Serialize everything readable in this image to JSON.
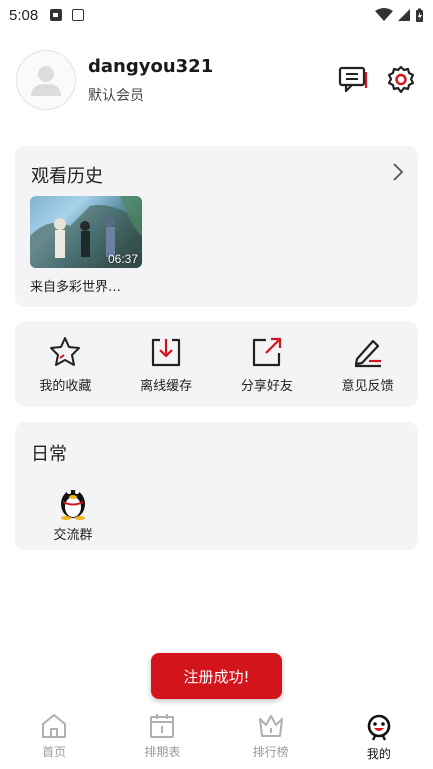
{
  "status_bar": {
    "time": "5:08"
  },
  "profile": {
    "username": "dangyou321",
    "member_level": "默认会员"
  },
  "history": {
    "title": "观看历史",
    "items": [
      {
        "caption": "来自多彩世界…",
        "duration": "06:37"
      }
    ]
  },
  "actions": [
    {
      "label": "我的收藏",
      "icon": "star-icon"
    },
    {
      "label": "离线缓存",
      "icon": "download-icon"
    },
    {
      "label": "分享好友",
      "icon": "share-icon"
    },
    {
      "label": "意见反馈",
      "icon": "feedback-pencil-icon"
    }
  ],
  "daily": {
    "title": "日常",
    "items": [
      {
        "label": "交流群",
        "icon": "qq-penguin-icon"
      }
    ]
  },
  "toast": {
    "text": "注册成功!"
  },
  "tabs": [
    {
      "label": "首页",
      "icon": "home-icon",
      "active": false
    },
    {
      "label": "排期表",
      "icon": "calendar-icon",
      "active": false
    },
    {
      "label": "排行榜",
      "icon": "crown-icon",
      "active": false
    },
    {
      "label": "我的",
      "icon": "profile-face-icon",
      "active": true
    }
  ],
  "colors": {
    "accent": "#d4141b",
    "card_bg": "#f4f4f6",
    "tab_inactive": "#9a9a9a"
  }
}
